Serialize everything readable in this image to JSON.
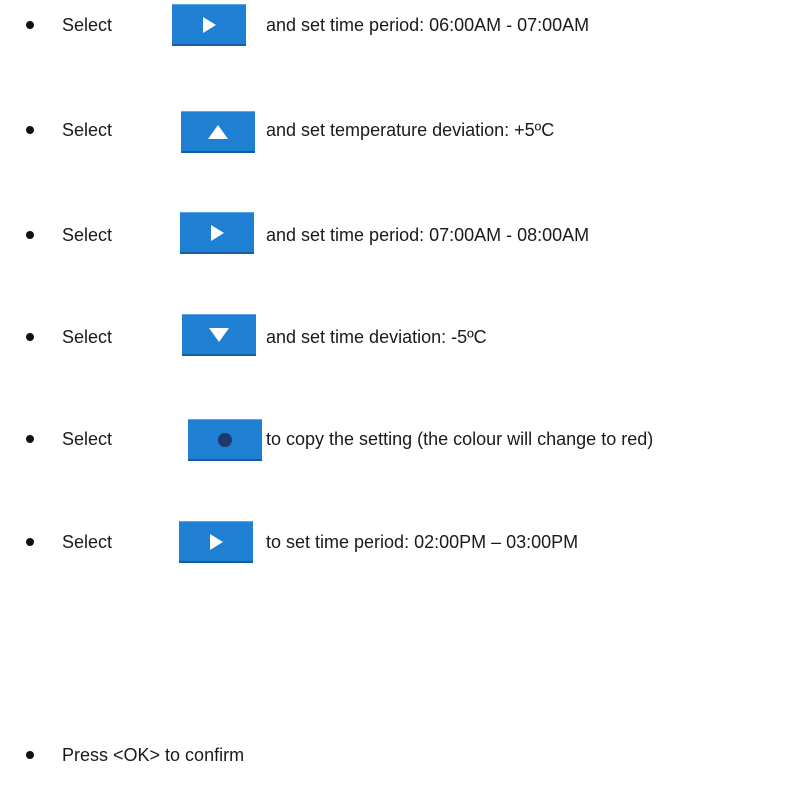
{
  "steps": [
    {
      "verb": "Select",
      "icon": "play-right-icon",
      "text": "and set time period: 06:00AM - 07:00AM"
    },
    {
      "verb": "Select",
      "icon": "triangle-up-icon",
      "text": "and set temperature deviation: +5ºC"
    },
    {
      "verb": "Select",
      "icon": "play-right-icon",
      "text": "and set time period:  07:00AM - 08:00AM"
    },
    {
      "verb": "Select",
      "icon": "triangle-down-icon",
      "text": "and set time deviation: -5ºC"
    },
    {
      "verb": "Select",
      "icon": "circle-dot-icon",
      "text": "to copy the setting (the colour will change to red)"
    },
    {
      "verb": "Select",
      "icon": "play-right-icon",
      "text": "to set time period: 02:00PM – 03:00PM"
    }
  ],
  "final_step": {
    "text": "Press <OK> to confirm"
  },
  "colors": {
    "button_blue": "#1f7fd3",
    "icon_white": "#ffffff",
    "dot_navy": "#1b3a6b"
  }
}
